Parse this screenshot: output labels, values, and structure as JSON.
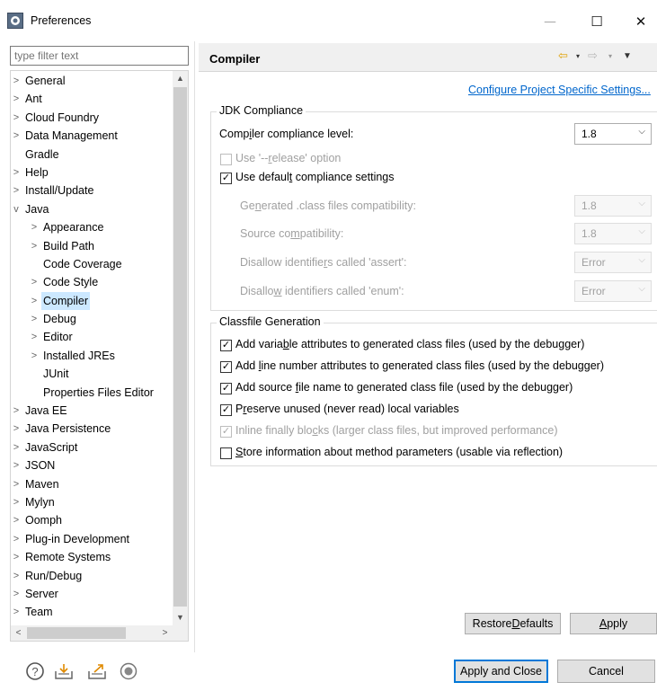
{
  "window": {
    "title": "Preferences",
    "minimize": "—",
    "maximize": "☐",
    "close": "✕"
  },
  "filter": {
    "placeholder": "type filter text"
  },
  "tree": [
    {
      "label": "General",
      "chevron": ">",
      "indent": 0
    },
    {
      "label": "Ant",
      "chevron": ">",
      "indent": 0
    },
    {
      "label": "Cloud Foundry",
      "chevron": ">",
      "indent": 0
    },
    {
      "label": "Data Management",
      "chevron": ">",
      "indent": 0
    },
    {
      "label": "Gradle",
      "chevron": "",
      "indent": 0
    },
    {
      "label": "Help",
      "chevron": ">",
      "indent": 0
    },
    {
      "label": "Install/Update",
      "chevron": ">",
      "indent": 0
    },
    {
      "label": "Java",
      "chevron": "v",
      "indent": 0
    },
    {
      "label": "Appearance",
      "chevron": ">",
      "indent": 1
    },
    {
      "label": "Build Path",
      "chevron": ">",
      "indent": 1
    },
    {
      "label": "Code Coverage",
      "chevron": "",
      "indent": 1
    },
    {
      "label": "Code Style",
      "chevron": ">",
      "indent": 1
    },
    {
      "label": "Compiler",
      "chevron": ">",
      "indent": 1,
      "selected": true
    },
    {
      "label": "Debug",
      "chevron": ">",
      "indent": 1
    },
    {
      "label": "Editor",
      "chevron": ">",
      "indent": 1
    },
    {
      "label": "Installed JREs",
      "chevron": ">",
      "indent": 1
    },
    {
      "label": "JUnit",
      "chevron": "",
      "indent": 1
    },
    {
      "label": "Properties Files Editor",
      "chevron": "",
      "indent": 1
    },
    {
      "label": "Java EE",
      "chevron": ">",
      "indent": 0
    },
    {
      "label": "Java Persistence",
      "chevron": ">",
      "indent": 0
    },
    {
      "label": "JavaScript",
      "chevron": ">",
      "indent": 0
    },
    {
      "label": "JSON",
      "chevron": ">",
      "indent": 0
    },
    {
      "label": "Maven",
      "chevron": ">",
      "indent": 0
    },
    {
      "label": "Mylyn",
      "chevron": ">",
      "indent": 0
    },
    {
      "label": "Oomph",
      "chevron": ">",
      "indent": 0
    },
    {
      "label": "Plug-in Development",
      "chevron": ">",
      "indent": 0
    },
    {
      "label": "Remote Systems",
      "chevron": ">",
      "indent": 0
    },
    {
      "label": "Run/Debug",
      "chevron": ">",
      "indent": 0
    },
    {
      "label": "Server",
      "chevron": ">",
      "indent": 0
    },
    {
      "label": "Team",
      "chevron": ">",
      "indent": 0
    }
  ],
  "scroll": {
    "up": "▲",
    "down": "▼",
    "left": "<",
    "right": ">"
  },
  "page": {
    "title": "Compiler",
    "nav": {
      "back": "⇦",
      "forward": "⇨",
      "dropdown": "▾",
      "menu": "▼"
    },
    "config_link": "Configure Project Specific Settings..."
  },
  "jdk": {
    "group_title": "JDK Compliance",
    "level_label": [
      "Comp",
      "i",
      "ler compliance level:"
    ],
    "level_value": "1.8",
    "release_label": [
      "Use '--",
      "r",
      "elease' option"
    ],
    "default_label": [
      "Use defaul",
      "t",
      " compliance settings"
    ],
    "default_checked": true,
    "generated_label": [
      "Ge",
      "n",
      "erated .class files compatibility:"
    ],
    "generated_value": "1.8",
    "source_label": [
      "Source co",
      "m",
      "patibility:"
    ],
    "source_value": "1.8",
    "assert_label": [
      "Disallow identifie",
      "r",
      "s called 'assert':"
    ],
    "assert_value": "Error",
    "enum_label": [
      "Disallo",
      "w",
      " identifiers called 'enum':"
    ],
    "enum_value": "Error"
  },
  "classfile": {
    "group_title": "Classfile Generation",
    "items": [
      {
        "pre": "Add varia",
        "key": "b",
        "post": "le attributes to generated class files (used by the debugger)",
        "checked": true,
        "disabled": false
      },
      {
        "pre": "Add ",
        "key": "l",
        "post": "ine number attributes to generated class files (used by the debugger)",
        "checked": true,
        "disabled": false
      },
      {
        "pre": "Add source ",
        "key": "f",
        "post": "ile name to generated class file (used by the debugger)",
        "checked": true,
        "disabled": false
      },
      {
        "pre": "P",
        "key": "r",
        "post": "eserve unused (never read) local variables",
        "checked": true,
        "disabled": false
      },
      {
        "pre": "Inline finally blo",
        "key": "c",
        "post": "ks (larger class files, but improved performance)",
        "checked": true,
        "disabled": true
      },
      {
        "pre": "",
        "key": "S",
        "post": "tore information about method parameters (usable via reflection)",
        "checked": false,
        "disabled": false
      }
    ]
  },
  "buttons": {
    "restore_defaults": [
      "Restore ",
      "D",
      "efaults"
    ],
    "apply": [
      "",
      "A",
      "pply"
    ],
    "apply_and_close": "Apply and Close",
    "cancel": "Cancel"
  },
  "checkmark": "✓",
  "caret": "⌵",
  "bottom_icons": [
    "help-icon",
    "import-icon",
    "export-icon",
    "record-icon"
  ]
}
